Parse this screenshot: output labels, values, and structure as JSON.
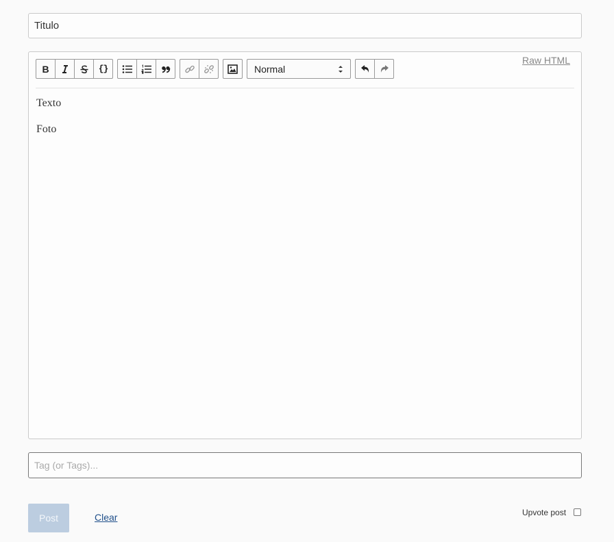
{
  "form": {
    "title_value": "Titulo",
    "raw_html_label": "Raw HTML",
    "format_select": {
      "selected": "Normal"
    },
    "content": {
      "paragraphs": [
        "Texto",
        "Foto"
      ]
    },
    "tags_placeholder": "Tag (or Tags)...",
    "post_label": "Post",
    "clear_label": "Clear",
    "upvote_label": "Upvote post"
  },
  "toolbar_icons": [
    "bold-icon",
    "italic-icon",
    "strikethrough-icon",
    "code-icon",
    "bullet-list-icon",
    "ordered-list-icon",
    "blockquote-icon",
    "link-icon",
    "unlink-icon",
    "image-icon",
    "undo-icon",
    "redo-icon"
  ]
}
